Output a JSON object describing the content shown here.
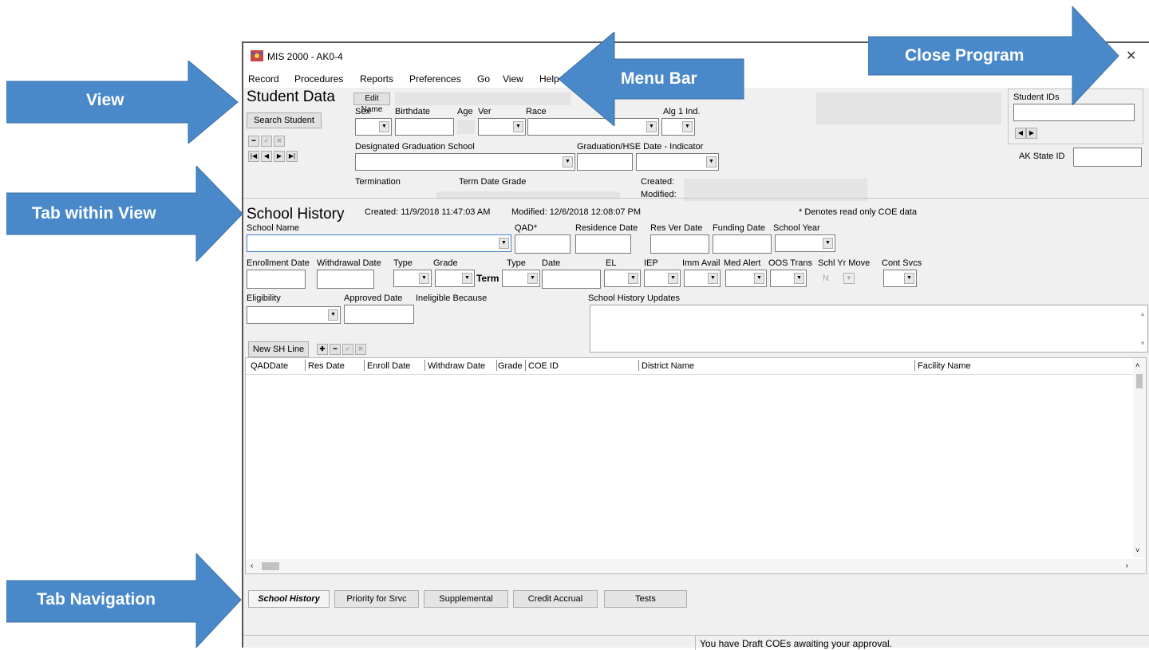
{
  "window": {
    "title": "MIS 2000 - AK0-4",
    "close_glyph": "✕"
  },
  "menu": [
    "Record",
    "Procedures",
    "Reports",
    "Preferences",
    "Go",
    "View",
    "Help"
  ],
  "student": {
    "heading": "Student Data",
    "edit_name": "Edit Name",
    "search": "Search Student",
    "labels": {
      "sex": "Sex",
      "birthdate": "Birthdate",
      "age": "Age",
      "ver": "Ver",
      "race": "Race",
      "alg1": "Alg 1 Ind.",
      "grad_school": "Designated Graduation School",
      "grad_date": "Graduation/HSE Date - Indicator",
      "termination": "Termination",
      "term_date_grade": "Term Date Grade",
      "created": "Created:",
      "modified": "Modified:",
      "student_ids": "Student IDs",
      "ak_state_id": "AK State ID"
    }
  },
  "school_history": {
    "heading": "School History",
    "created": "Created: 11/9/2018 11:47:03 AM",
    "modified": "Modified: 12/6/2018 12:08:07 PM",
    "note": "* Denotes read only COE data",
    "labels": {
      "school_name": "School Name",
      "qad": "QAD*",
      "residence_date": "Residence Date",
      "res_ver_date": "Res Ver Date",
      "funding_date": "Funding Date",
      "school_year": "School Year",
      "enrollment_date": "Enrollment Date",
      "withdrawal_date": "Withdrawal Date",
      "type": "Type",
      "grade": "Grade",
      "term": "Term",
      "type2": "Type",
      "date": "Date",
      "el": "EL",
      "iep": "IEP",
      "imm_avail": "Imm Avail",
      "med_alert": "Med Alert",
      "oos_trans": "OOS Trans",
      "schl_yr_move": "Schl Yr Move",
      "cont_svcs": "Cont Svcs",
      "eligibility": "Eligibility",
      "approved_date": "Approved Date",
      "ineligible_because": "Ineligible Because",
      "updates": "School History Updates"
    },
    "schl_yr_move_value": "N",
    "new_sh_line": "New SH Line",
    "columns": [
      "QADDate",
      "Res Date",
      "Enroll Date",
      "Withdraw Date",
      "Grade",
      "COE ID",
      "District Name",
      "Facility Name"
    ]
  },
  "tabs": [
    "School History",
    "Priority for Srvc",
    "Supplemental",
    "Credit Accrual",
    "Tests"
  ],
  "status": "You have Draft COEs awaiting your approval.",
  "annotations": {
    "view": "View",
    "menu_bar": "Menu Bar",
    "close_program": "Close Program",
    "tab_within_view": "Tab within View",
    "tab_navigation": "Tab Navigation"
  },
  "colors": {
    "arrow_fill": "#4a89c9",
    "window_bg": "#f0f0f0"
  }
}
